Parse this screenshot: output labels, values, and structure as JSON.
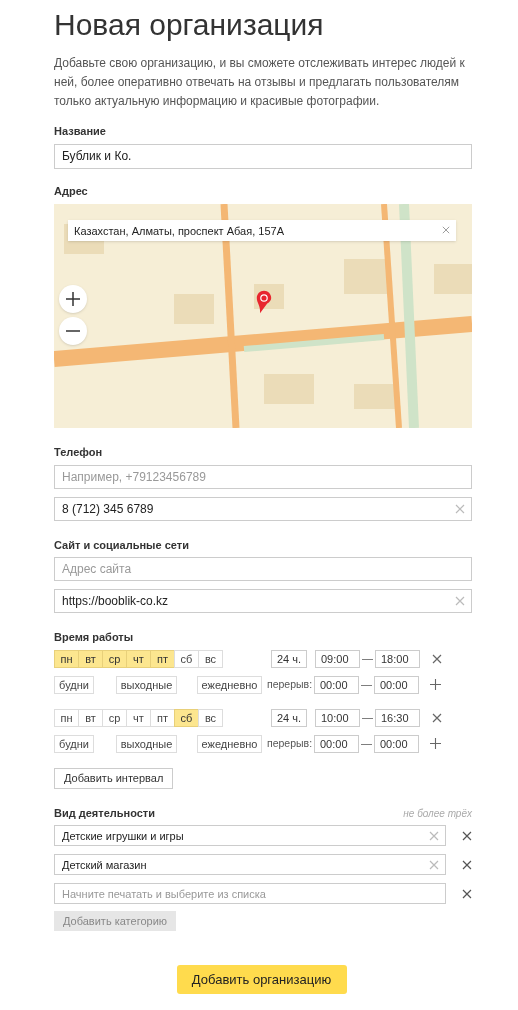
{
  "title": "Новая организация",
  "intro": "Добавьте свою организацию, и вы сможете отслеживать интерес людей к ней, более оперативно отвечать на отзывы и предлагать пользователям только актуальную информацию и красивые фотографии.",
  "name_field": {
    "label": "Название",
    "value": "Бублик и Ко."
  },
  "address": {
    "label": "Адрес",
    "search_value": "Казахстан, Алматы, проспект Абая, 157А"
  },
  "phone": {
    "label": "Телефон",
    "fields": [
      {
        "placeholder": "Например, +79123456789"
      },
      {
        "value": "8 (712) 345 6789"
      }
    ]
  },
  "site": {
    "label": "Сайт и социальные сети",
    "fields": [
      {
        "placeholder": "Адрес сайта"
      },
      {
        "value": "https://booblik-co.kz"
      }
    ]
  },
  "hours": {
    "label": "Время работы",
    "intervals": [
      {
        "days": [
          {
            "label": "пн",
            "selected": true
          },
          {
            "label": "вт",
            "selected": true
          },
          {
            "label": "ср",
            "selected": true
          },
          {
            "label": "чт",
            "selected": true
          },
          {
            "label": "пт",
            "selected": true
          },
          {
            "label": "сб",
            "selected": false
          },
          {
            "label": "вс",
            "selected": false
          }
        ],
        "all_day": "24 ч.",
        "from": "09:00",
        "separator": "—",
        "to": "18:00",
        "presets": [
          "будни",
          "выходные",
          "ежедневно"
        ],
        "break_label": "перерыв:",
        "break_from": "00:00",
        "break_separator": "—",
        "break_to": "00:00"
      },
      {
        "days": [
          {
            "label": "пн",
            "selected": false
          },
          {
            "label": "вт",
            "selected": false
          },
          {
            "label": "ср",
            "selected": false
          },
          {
            "label": "чт",
            "selected": false
          },
          {
            "label": "пт",
            "selected": false
          },
          {
            "label": "сб",
            "selected": true
          },
          {
            "label": "вс",
            "selected": false
          }
        ],
        "all_day": "24 ч.",
        "from": "10:00",
        "separator": "—",
        "to": "16:30",
        "presets": [
          "будни",
          "выходные",
          "ежедневно"
        ],
        "break_label": "перерыв:",
        "break_from": "00:00",
        "break_separator": "—",
        "break_to": "00:00"
      }
    ],
    "add_button": "Добавить интервал"
  },
  "activity": {
    "label": "Вид деятельности",
    "hint": "не более трёх",
    "fields": [
      {
        "value": "Детские игрушки и игры"
      },
      {
        "value": "Детский магазин"
      },
      {
        "placeholder": "Начните печатать и выберите из списка"
      }
    ],
    "add_button": {
      "label": "Добавить категорию",
      "disabled": true
    }
  },
  "submit": "Добавить организацию"
}
